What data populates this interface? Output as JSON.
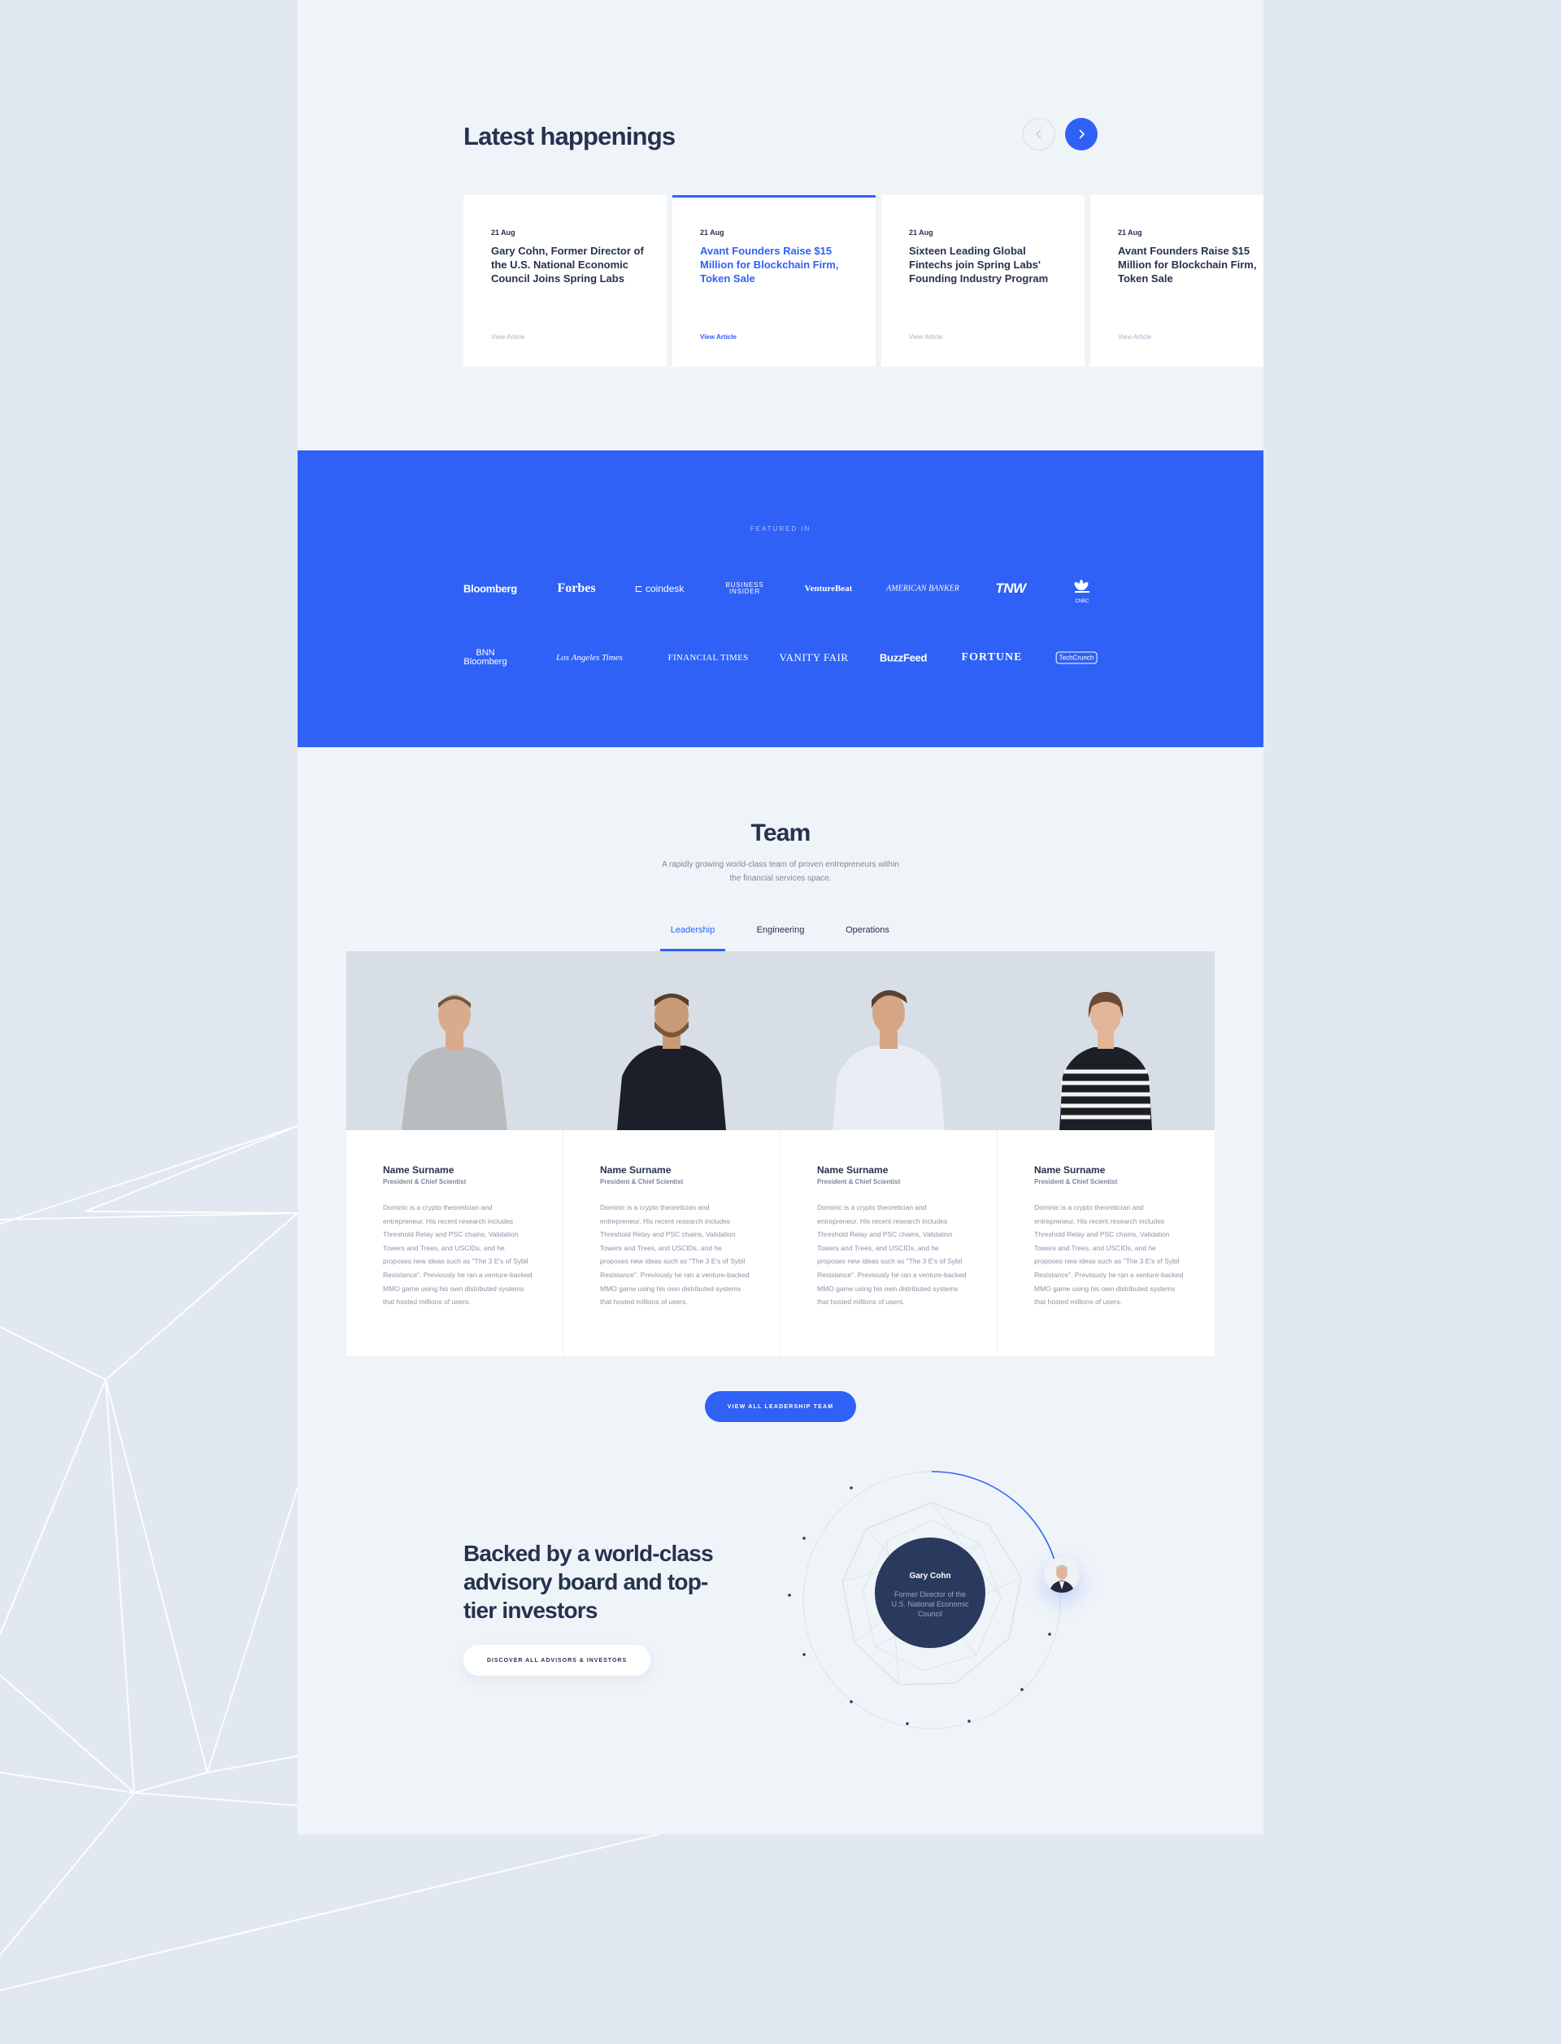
{
  "colors": {
    "accent": "#2f61f7",
    "dark": "#26324e",
    "page_bg": "#eff4f9",
    "outer_bg": "#e1e8f1"
  },
  "news": {
    "title": "Latest happenings",
    "prev_icon": "chevron-left-icon",
    "next_icon": "chevron-right-icon",
    "cards": [
      {
        "date": "21 Aug",
        "title": "Gary Cohn, Former Director of the U.S. National Economic Council Joins Spring Labs",
        "link": "View Article"
      },
      {
        "date": "21 Aug",
        "title": "Avant Founders Raise $15 Million for Blockchain Firm, Token Sale",
        "link": "View Article"
      },
      {
        "date": "21 Aug",
        "title": "Sixteen Leading Global Fintechs join Spring Labs' Founding Industry Program",
        "link": "View Article"
      },
      {
        "date": "21 Aug",
        "title": "Avant Founders Raise $15 Million for Blockchain Firm, Token Sale",
        "link": "View Article"
      }
    ]
  },
  "featured": {
    "label": "FEATURED IN",
    "logos_row1": [
      "Bloomberg",
      "Forbes",
      "coindesk",
      "BUSINESS INSIDER",
      "VentureBeat",
      "AMERICAN BANKER",
      "TNW",
      "CNBC"
    ],
    "logos_row2": [
      "BNN Bloomberg",
      "Los Angeles Times",
      "FINANCIAL TIMES",
      "VANITY FAIR",
      "BuzzFeed",
      "FORTUNE",
      "TechCrunch"
    ]
  },
  "team": {
    "title": "Team",
    "subtitle": "A rapidly growing world-class team of proven entrepreneurs within the financial services space.",
    "tabs": [
      "Leadership",
      "Engineering",
      "Operations"
    ],
    "members": [
      {
        "name": "Name Surname",
        "role": "President & Chief Scientist",
        "bio": "Dominic is a crypto theoretician and entrepreneur. His recent research includes Threshold Relay and PSC chains, Validation Towers and Trees, and USCIDs, and he proposes new ideas such as \"The 3 E's of Sybil Resistance\". Previously he ran a venture-backed MMO game using his own distributed systems that hosted millions of users."
      },
      {
        "name": "Name Surname",
        "role": "President & Chief Scientist",
        "bio": "Dominic is a crypto theoretician and entrepreneur. His recent research includes Threshold Relay and PSC chains, Validation Towers and Trees, and USCIDs, and he proposes new ideas such as \"The 3 E's of Sybil Resistance\". Previously he ran a venture-backed MMO game using his own distributed systems that hosted millions of users."
      },
      {
        "name": "Name Surname",
        "role": "President & Chief Scientist",
        "bio": "Dominic is a crypto theoretician and entrepreneur. His recent research includes Threshold Relay and PSC chains, Validation Towers and Trees, and USCIDs, and he proposes new ideas such as \"The 3 E's of Sybil Resistance\". Previously he ran a venture-backed MMO game using his own distributed systems that hosted millions of users."
      },
      {
        "name": "Name Surname",
        "role": "President & Chief Scientist",
        "bio": "Dominic is a crypto theoretician and entrepreneur. His recent research includes Threshold Relay and PSC chains, Validation Towers and Trees, and USCIDs, and he proposes new ideas such as \"The 3 E's of Sybil Resistance\". Previously he ran a venture-backed MMO game using his own distributed systems that hosted millions of users."
      }
    ],
    "cta": "VIEW ALL LEADERSHIP TEAM"
  },
  "advisory": {
    "title": "Backed by a world-class advisory board and top-tier investors",
    "button": "DISCOVER ALL ADVISORS & INVESTORS",
    "featured_name": "Gary Cohn",
    "featured_role": "Former Director of the U.S. National Economic Council"
  }
}
